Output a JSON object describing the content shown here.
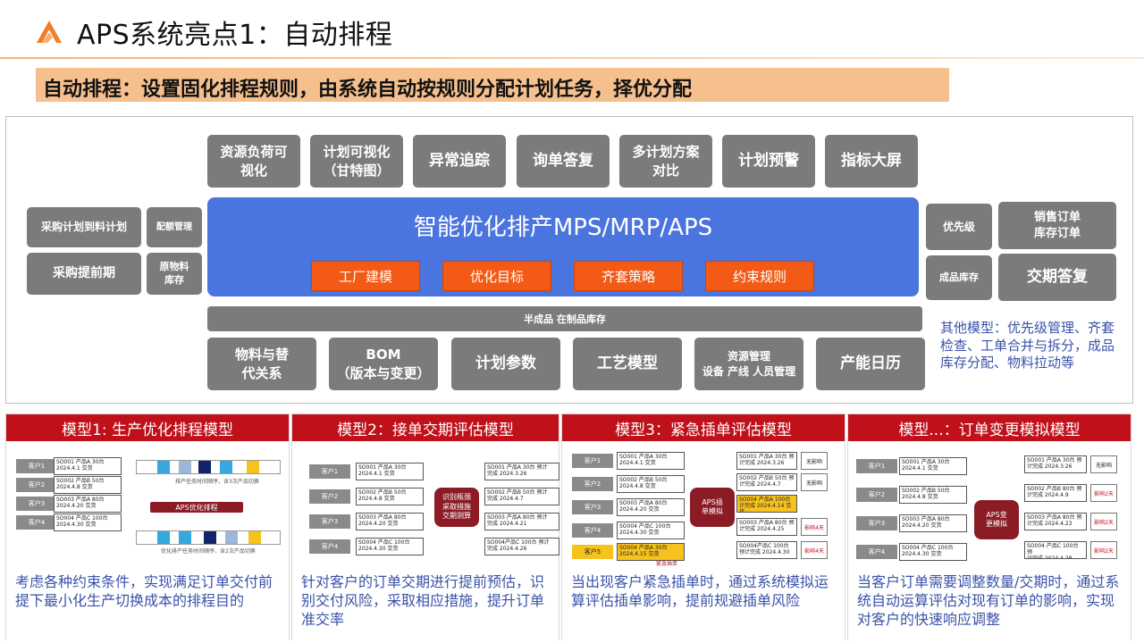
{
  "title": "APS系统亮点1：自动排程",
  "subtitle": "自动排程：设置固化排程规则，由系统自动按规则分配计划任务，择优分配",
  "colors": {
    "accent_orange": "#f6c08e",
    "core_blue": "#4a74de",
    "tag_orange": "#f25a16",
    "panel_red": "#c0101a",
    "box_gray": "#7b7b7b",
    "note_blue": "#3a52a8"
  },
  "top_boxes": [
    "资源负荷可\n视化",
    "计划可视化\n（甘特图）",
    "异常追踪",
    "询单答复",
    "多计划方案\n对比",
    "计划预警",
    "指标大屏"
  ],
  "core": {
    "title": "智能优化排产MPS/MRP/APS",
    "tags": [
      "工厂建模",
      "优化目标",
      "齐套策略",
      "约束规则"
    ]
  },
  "wip_bar": "半成品 在制品库存",
  "bottom_boxes": [
    "物料与替\n代关系",
    "BOM\n（版本与变更）",
    "计划参数",
    "工艺模型",
    "资源管理\n设备 产线 人员管理",
    "产能日历"
  ],
  "left_boxes": [
    "采购计划到料计划",
    "配额管理",
    "采购提前期",
    "原物料\n库存"
  ],
  "right_boxes": [
    "优先级",
    "销售订单\n库存订单",
    "成品库存",
    "交期答复"
  ],
  "other_note": "其他模型：优先级管理、齐套检查、工单合并与拆分，成品库存分配、物料拉动等",
  "panels": [
    {
      "title": "模型1: 生产优化排程模型",
      "desc": "考虑各种约束条件，实现满足订单交付前提下最小化生产切换成本的排程目的",
      "customers": [
        "客户1",
        "客户2",
        "客户3",
        "客户4"
      ],
      "orders": [
        "SO001 产品A 30台\n2024.4.1 交货",
        "SO002 产品B 50台\n2024.4.8 交货",
        "SO003 产品A 80台\n2024.4.20 交货",
        "SO004 产品C 100台\n2024.4.30 交货"
      ],
      "seq_note_top": "排产任务时间顺序，含3次产品切换",
      "aps_label": "APS优化排程",
      "seq_note_bottom": "优化排产任务时间顺序，含2次产品切换"
    },
    {
      "title": "模型2：接单交期评估模型",
      "desc": "针对客户的订单交期进行提前预估，识别交付风险，采取相应措施，提升订单准交率",
      "customers": [
        "客户1",
        "客户2",
        "客户3",
        "客户4"
      ],
      "orders": [
        "SO001 产品A 30台\n2024.4.1 交货",
        "SO002 产品B 50台\n2024.4.8 交货",
        "SO003 产品A 80台\n2024.4.20 交货",
        "SO004 产品C 100台\n2024.4.30 交货"
      ],
      "engine": "识别瓶颈\n采取措施\n交期测算",
      "results": [
        "SO001 产品A 30台 预计\n完成 2024.3.26",
        "SO002 产品B 50台 预计\n完成 2024.4.7",
        "SO003 产品A 80台 预计\n完成 2024.4.21",
        "SO004产品C 100台 预计\n完成 2024.4.26"
      ]
    },
    {
      "title": "模型3：紧急插单评估模型",
      "desc": "当出现客户紧急插单时，通过系统模拟运算评估插单影响，提前规避插单风险",
      "customers": [
        "客户1",
        "客户2",
        "客户3",
        "客户4",
        "客户5"
      ],
      "orders": [
        "SO001 产品A 30台\n2024.4.1 交货",
        "SO002 产品B 50台\n2024.4.8 交货",
        "SO003 产品A 80台\n2024.4.20 交货",
        "SO004 产品C 100台\n2024.4.30 交货",
        "SO004 产品A 30台\n2024.4.15 交货"
      ],
      "urgent_label": "紧急插单",
      "engine": "APS插\n单模拟",
      "results": [
        "SO001 产品A 30台 预\n计完成 2024.3.26",
        "SO002 产品B 50台 预\n计完成 2024.4.7",
        "SO004 产品A 100台\n计完成 2024.4.14 交货",
        "SO003 产品A 80台 预\n计完成 2024.4.25",
        "SO004产品C 100台\n预计完成 2024.4.30"
      ],
      "tags": [
        "无影响",
        "无影响",
        "影响4天",
        "影响4天"
      ]
    },
    {
      "title": "模型...：订单变更模拟模型",
      "desc": "当客户订单需要调整数量/交期时，通过系统自动运算评估对现有订单的影响，实现对客户的快速响应调整",
      "customers": [
        "客户1",
        "客户2",
        "客户3",
        "客户4"
      ],
      "orders": [
        "SO001 产品A 30台\n2024.4.1 交货",
        "SO002 产品B 50台\n2024.4.8 交货",
        "SO003 产品A 80台\n2024.4.20 交货",
        "SO004 产品C 100台\n2024.4.30 交货"
      ],
      "engine": "APS变\n更模拟",
      "results": [
        "SO001 产品A 30台 预\n计完成 2024.3.26",
        "SO002 产品B 80台 预\n计完成 2024.4.9",
        "SO003 产品A 80台 预\n计完成 2024.4.23",
        "SO004 产品C 100台 预\n计完成 2024.4.28"
      ],
      "tags": [
        "无影响",
        "影响2天",
        "影响2天",
        "影响2天"
      ]
    }
  ]
}
